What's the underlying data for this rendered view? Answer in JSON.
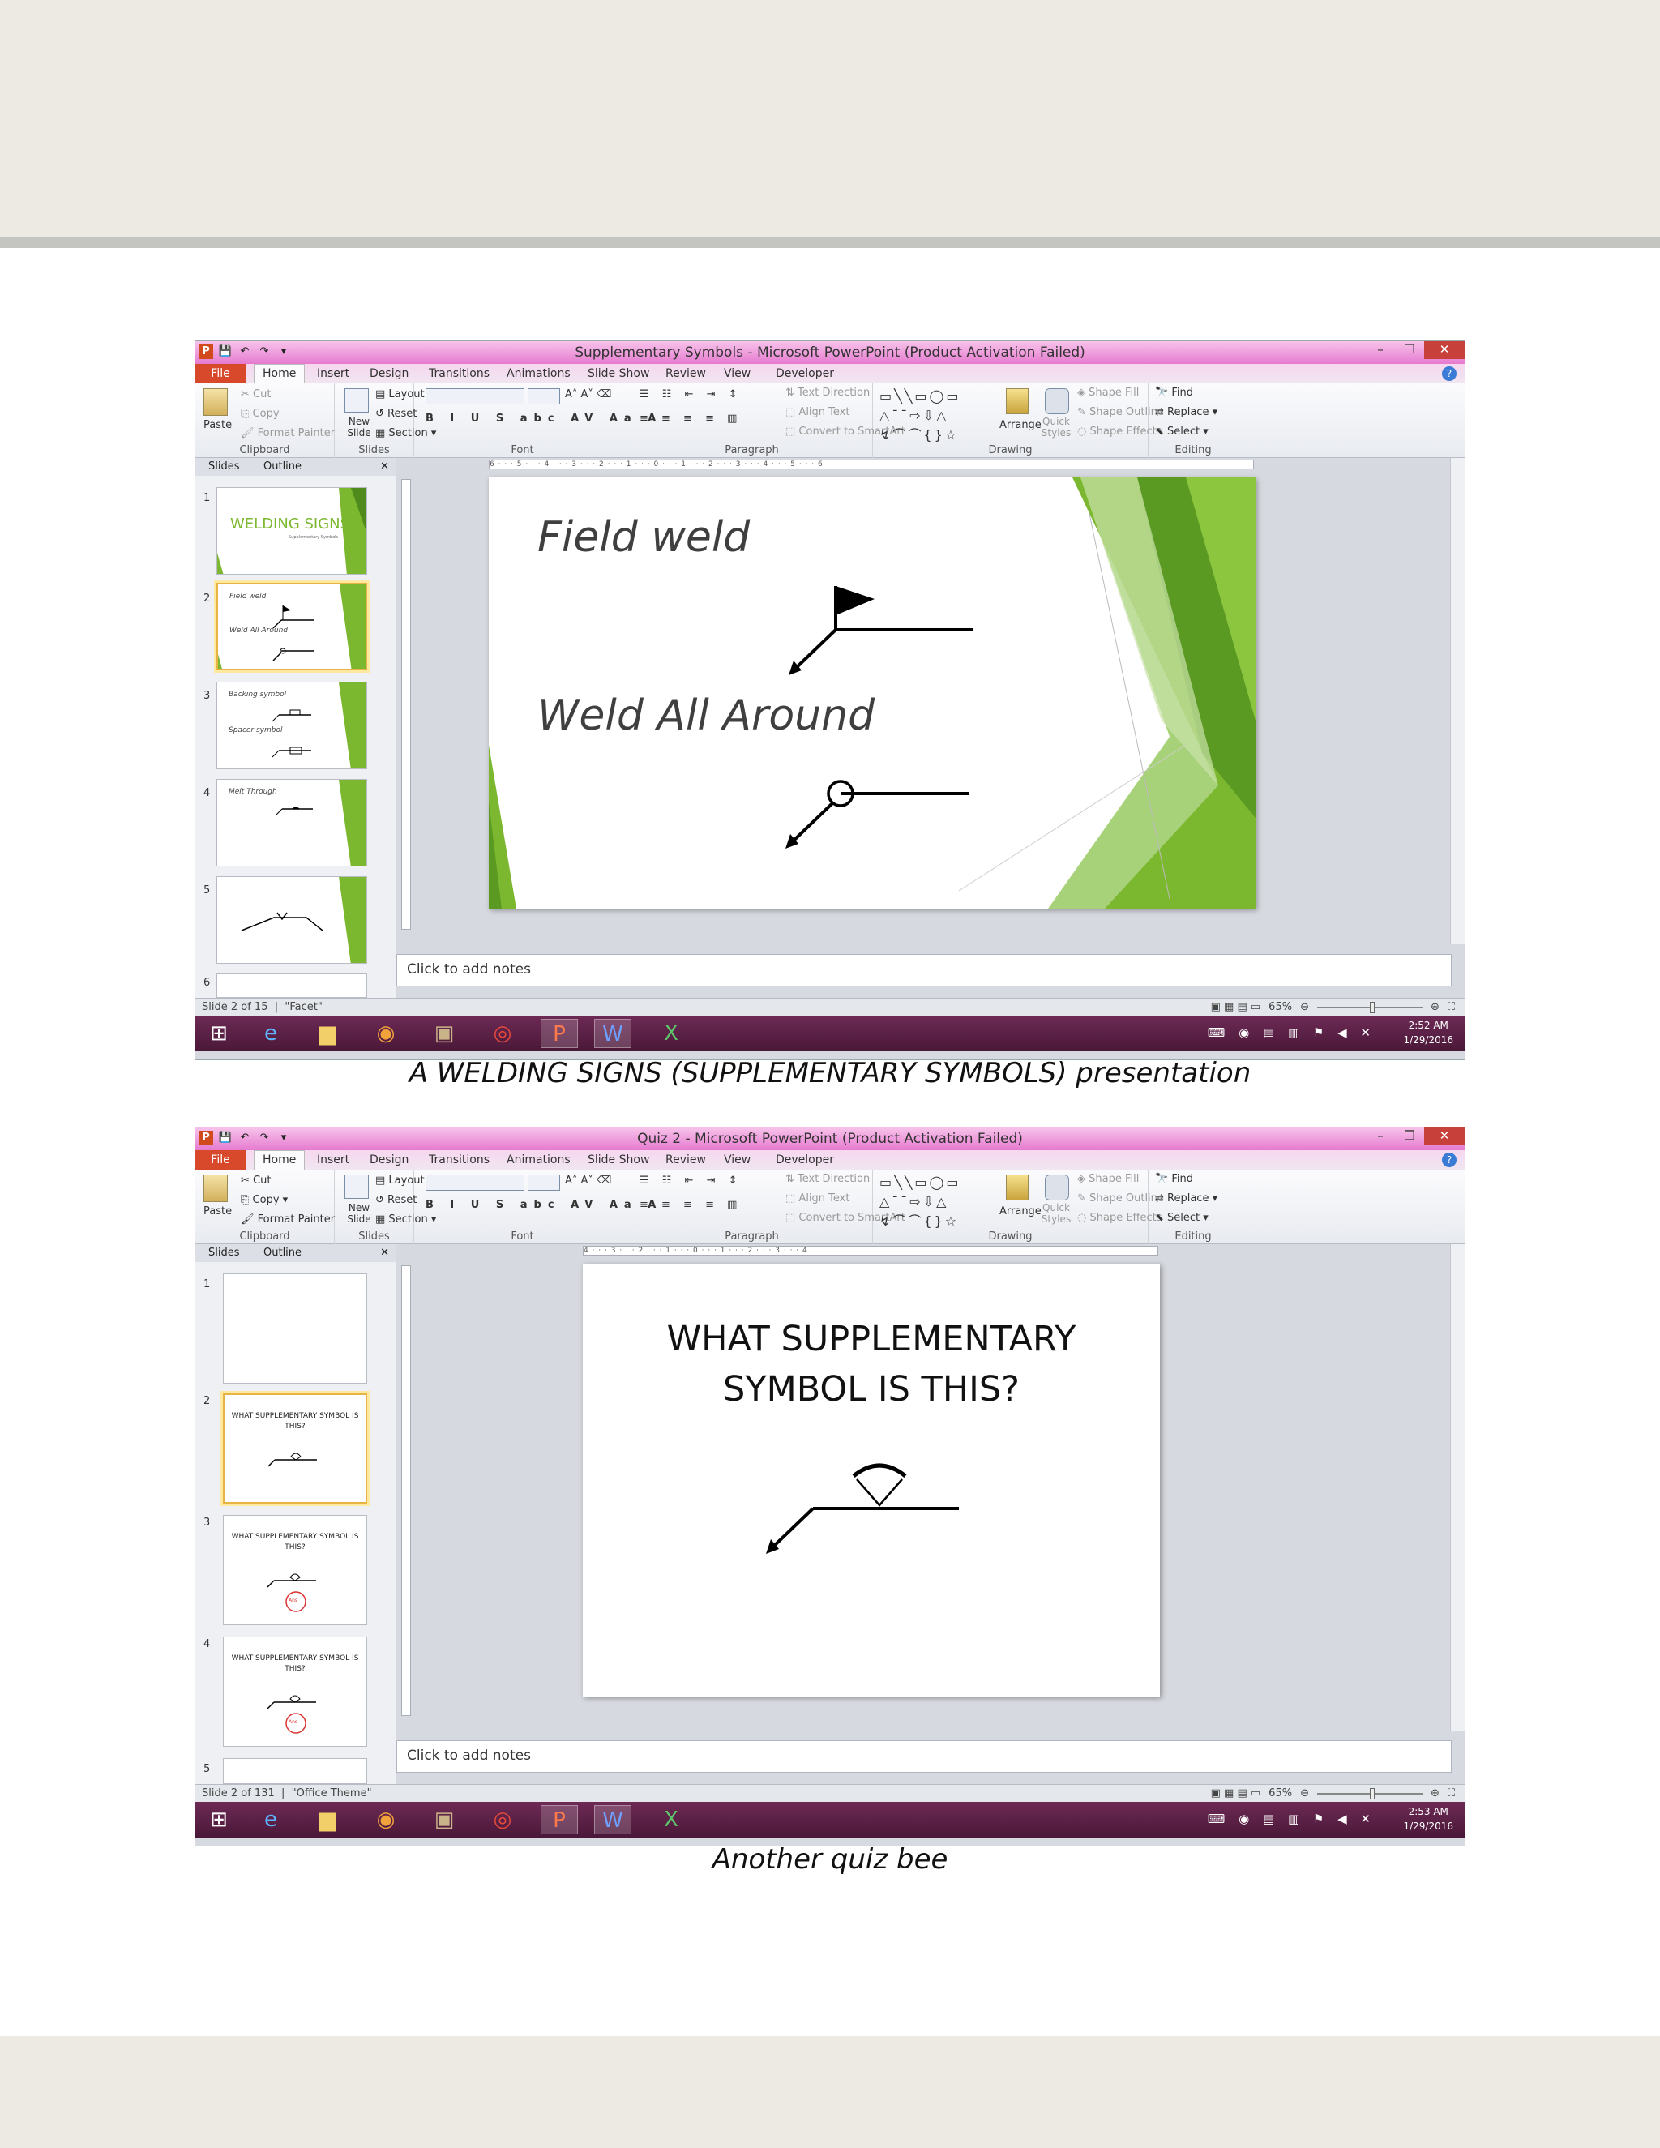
{
  "windows": [
    {
      "title": "Supplementary Symbols - Microsoft PowerPoint (Product Activation Failed)",
      "tabs": [
        "File",
        "Home",
        "Insert",
        "Design",
        "Transitions",
        "Animations",
        "Slide Show",
        "Review",
        "View",
        "Developer"
      ],
      "ribbon": {
        "clipboard": {
          "paste": "Paste",
          "cut": "Cut",
          "copy": "Copy",
          "format_painter": "Format Painter",
          "label": "Clipboard"
        },
        "slides": {
          "new_slide": "New Slide",
          "layout": "Layout",
          "reset": "Reset",
          "section": "Section",
          "label": "Slides"
        },
        "font": {
          "label": "Font"
        },
        "paragraph": {
          "text_direction": "Text Direction",
          "align_text": "Align Text",
          "convert_smartart": "Convert to SmartArt",
          "label": "Paragraph"
        },
        "drawing": {
          "arrange": "Arrange",
          "quick_styles": "Quick Styles",
          "shape_fill": "Shape Fill",
          "shape_outline": "Shape Outline",
          "shape_effects": "Shape Effects",
          "label": "Drawing"
        },
        "editing": {
          "find": "Find",
          "replace": "Replace",
          "select": "Select",
          "label": "Editing"
        }
      },
      "pane_tabs": [
        "Slides",
        "Outline"
      ],
      "thumbs": [
        {
          "num": "1",
          "title": "WELDING SIGNS",
          "subtitle": "Supplementary Symbols"
        },
        {
          "num": "2",
          "line1": "Field weld",
          "line2": "Weld All Around"
        },
        {
          "num": "3",
          "line1": "Backing symbol",
          "line2": "Spacer symbol"
        },
        {
          "num": "4",
          "line1": "Melt Through"
        },
        {
          "num": "5"
        },
        {
          "num": "6"
        }
      ],
      "ruler_text": "6 · · · 5 · · · 4 · · · 3 · · · 2 · · · 1 · · · 0 · · · 1 · · · 2 · · · 3 · · · 4 · · · 5 · · · 6",
      "slide": {
        "title1": "Field weld",
        "title2": "Weld All Around"
      },
      "notes": "Click to add notes",
      "status": {
        "slide": "Slide 2 of 15",
        "theme": "\"Facet\"",
        "zoom": "65%"
      },
      "clock": {
        "time": "2:52 AM",
        "date": "1/29/2016"
      }
    },
    {
      "title": "Quiz 2 - Microsoft PowerPoint (Product Activation Failed)",
      "tabs": [
        "File",
        "Home",
        "Insert",
        "Design",
        "Transitions",
        "Animations",
        "Slide Show",
        "Review",
        "View",
        "Developer"
      ],
      "ribbon": {
        "clipboard": {
          "paste": "Paste",
          "cut": "Cut",
          "copy": "Copy",
          "format_painter": "Format Painter",
          "label": "Clipboard"
        },
        "slides": {
          "new_slide": "New Slide",
          "layout": "Layout",
          "reset": "Reset",
          "section": "Section",
          "label": "Slides"
        },
        "font": {
          "label": "Font"
        },
        "paragraph": {
          "text_direction": "Text Direction",
          "align_text": "Align Text",
          "convert_smartart": "Convert to SmartArt",
          "label": "Paragraph"
        },
        "drawing": {
          "arrange": "Arrange",
          "quick_styles": "Quick Styles",
          "shape_fill": "Shape Fill",
          "shape_outline": "Shape Outline",
          "shape_effects": "Shape Effects",
          "label": "Drawing"
        },
        "editing": {
          "find": "Find",
          "replace": "Replace",
          "select": "Select",
          "label": "Editing"
        }
      },
      "pane_tabs": [
        "Slides",
        "Outline"
      ],
      "thumbs": [
        {
          "num": "1"
        },
        {
          "num": "2",
          "caption": "WHAT SUPPLEMENTARY SYMBOL IS THIS?"
        },
        {
          "num": "3",
          "caption": "WHAT SUPPLEMENTARY SYMBOL IS THIS?",
          "badge": "Ans"
        },
        {
          "num": "4",
          "caption": "WHAT SUPPLEMENTARY SYMBOL IS THIS?",
          "badge": "Ans"
        },
        {
          "num": "5"
        }
      ],
      "ruler_text": "4 · · · 3 · · · 2 · · · 1 · · · 0 · · · 1 · · · 2 · · · 3 · · · 4",
      "slide": {
        "title_line1": "WHAT SUPPLEMENTARY",
        "title_line2": "SYMBOL IS THIS?"
      },
      "notes": "Click to add notes",
      "status": {
        "slide": "Slide 2 of 131",
        "theme": "\"Office Theme\"",
        "zoom": "65%"
      },
      "clock": {
        "time": "2:53 AM",
        "date": "1/29/2016"
      }
    }
  ],
  "captions": {
    "first": "A WELDING SIGNS (SUPPLEMENTARY SYMBOLS) presentation",
    "second": "Another quiz bee"
  },
  "colors": {
    "accent_pink": "#e67ad0",
    "file_tab": "#d8482a",
    "taskbar": "#5a1f45",
    "green": "#7cb82f"
  }
}
